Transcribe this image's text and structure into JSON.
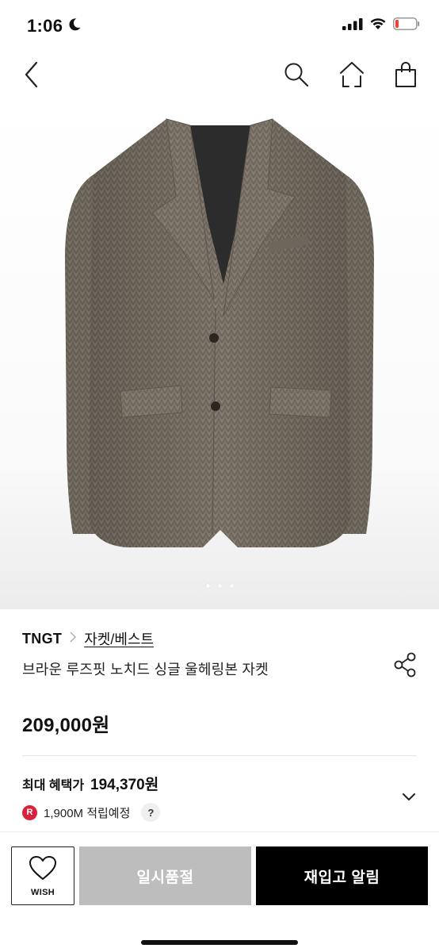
{
  "status_bar": {
    "time": "1:06",
    "icons": [
      "moon-icon",
      "cellular-signal-icon",
      "wifi-icon",
      "battery-low-icon"
    ],
    "battery_color": "#ff3b30"
  },
  "nav": {
    "icons": [
      "back-chevron-icon",
      "search-icon",
      "home-icon",
      "shopping-bag-icon"
    ]
  },
  "gallery": {
    "image_description_icon": "wool-herringbone-jacket-image",
    "page_count": 3,
    "current_page": 1
  },
  "product": {
    "brand": "TNGT",
    "category": "자켓/베스트",
    "title": "브라운 루즈핏 노치드 싱글 울헤링본 자켓",
    "price": "209,000원"
  },
  "benefit": {
    "label": "최대 혜택가",
    "price": "194,370원"
  },
  "points": {
    "badge": "R",
    "text": "1,900M 적립예정",
    "help": "?"
  },
  "bottom_bar": {
    "wish_label": "WISH",
    "soldout_label": "일시품절",
    "restock_label": "재입고 알림"
  },
  "colors": {
    "soldout_bg": "#bdbdbd",
    "restock_bg": "#000000",
    "point_badge": "#d8213b"
  }
}
